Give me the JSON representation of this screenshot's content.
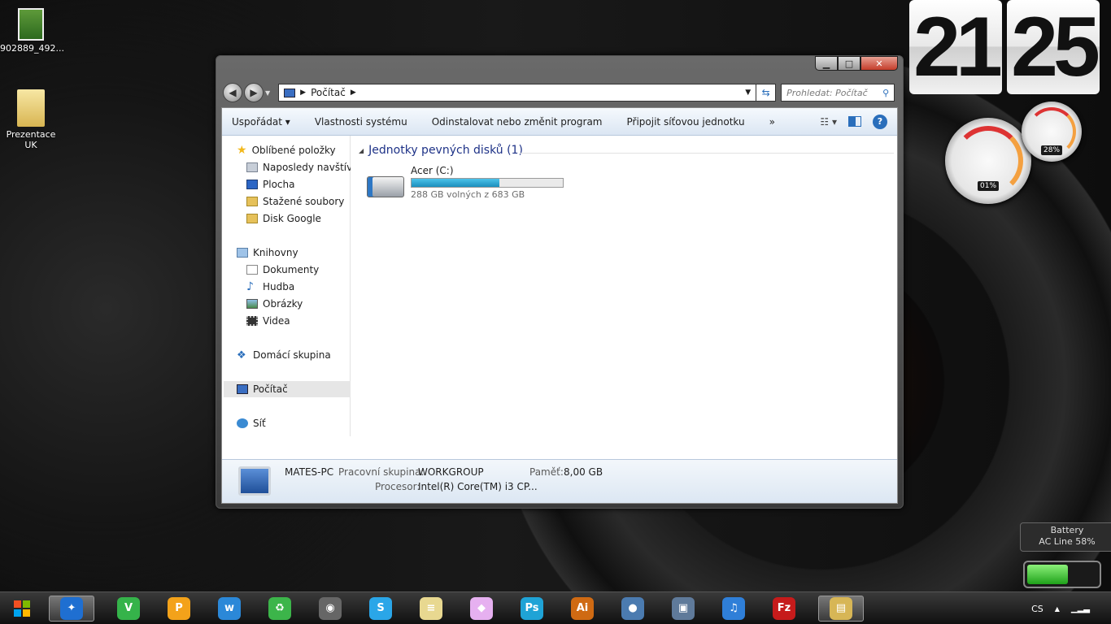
{
  "desktop": {
    "icons": [
      {
        "label": "902889_492..."
      },
      {
        "label": "Prezentace UK"
      }
    ],
    "clock": {
      "hours": "21",
      "minutes": "25"
    },
    "gauges": {
      "cpu": "01%",
      "memory": "28%"
    },
    "battery": {
      "title": "Battery",
      "status": "AC Line 58%",
      "level": 0.58
    }
  },
  "window": {
    "address": {
      "root": "Počítač"
    },
    "search_placeholder": "Prohledat: Počítač",
    "commands": [
      "Uspořádat",
      "Vlastnosti systému",
      "Odinstalovat nebo změnit program",
      "Připojit síťovou jednotku",
      "»"
    ],
    "nav": {
      "favorites": {
        "label": "Oblíbené položky",
        "items": [
          "Naposledy navštívené",
          "Plocha",
          "Stažené soubory",
          "Disk Google"
        ]
      },
      "libraries": {
        "label": "Knihovny",
        "items": [
          "Dokumenty",
          "Hudba",
          "Obrázky",
          "Videa"
        ]
      },
      "homegroup": "Domácí skupina",
      "computer": "Počítač",
      "network": "Síť"
    },
    "group": {
      "title": "Jednotky pevných disků (1)"
    },
    "drive": {
      "name": "Acer (C:)",
      "free_text": "288 GB volných z 683 GB",
      "used_fraction": 0.58
    },
    "details": {
      "pc_name": "MATES-PC",
      "workgroup_label": "Pracovní skupina:",
      "workgroup": "WORKGROUP",
      "memory_label": "Paměť:",
      "memory": "8,00 GB",
      "cpu_label": "Procesor:",
      "cpu": "Intel(R) Core(TM) i3 CP..."
    }
  },
  "taskbar": {
    "apps": [
      {
        "name": "safari",
        "color": "#1f6fd1",
        "glyph": "✦"
      },
      {
        "name": "vine",
        "color": "#35b34a",
        "glyph": "V"
      },
      {
        "name": "pages",
        "color": "#f3a21a",
        "glyph": "P"
      },
      {
        "name": "wunderlist",
        "color": "#2b88d8",
        "glyph": "w"
      },
      {
        "name": "recycle",
        "color": "#3cb54a",
        "glyph": "♻"
      },
      {
        "name": "camera",
        "color": "#666666",
        "glyph": "◉"
      },
      {
        "name": "skype",
        "color": "#2aa6e8",
        "glyph": "S"
      },
      {
        "name": "notes",
        "color": "#e8d890",
        "glyph": "≡"
      },
      {
        "name": "prism",
        "color": "#e6b0f0",
        "glyph": "◆"
      },
      {
        "name": "photoshop",
        "color": "#1fa3d6",
        "glyph": "Ps"
      },
      {
        "name": "illustrator",
        "color": "#cf6a13",
        "glyph": "Ai"
      },
      {
        "name": "network-app",
        "color": "#4b7bb0",
        "glyph": "●"
      },
      {
        "name": "gallery",
        "color": "#5f7a9a",
        "glyph": "▣"
      },
      {
        "name": "itunes",
        "color": "#2f7fd8",
        "glyph": "♫"
      },
      {
        "name": "filezilla",
        "color": "#c61b1b",
        "glyph": "Fz"
      },
      {
        "name": "explorer",
        "color": "#d7b656",
        "glyph": "▤"
      }
    ],
    "language": "CS"
  }
}
